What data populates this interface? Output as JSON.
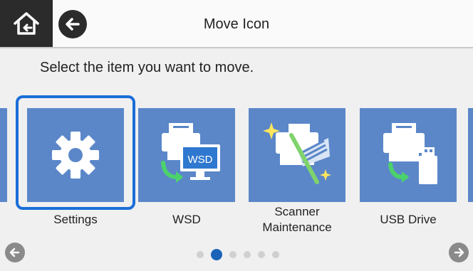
{
  "header": {
    "title": "Move Icon",
    "home_icon": "home-icon",
    "back_icon": "arrow-left-icon"
  },
  "instruction": "Select the item you want to move.",
  "tiles": [
    {
      "label": "Settings",
      "icon": "gear-icon",
      "selected": true
    },
    {
      "label": "WSD",
      "icon": "wsd-scanner-icon",
      "badge": "WSD"
    },
    {
      "label": "Scanner\nMaintenance",
      "icon": "scanner-maintenance-icon"
    },
    {
      "label": "USB Drive",
      "icon": "usb-drive-icon"
    }
  ],
  "pager": {
    "pages": 6,
    "current": 2
  },
  "colors": {
    "tile": "#5b87c9",
    "selection": "#1a6ed8",
    "header_button": "#2b2b2b"
  }
}
